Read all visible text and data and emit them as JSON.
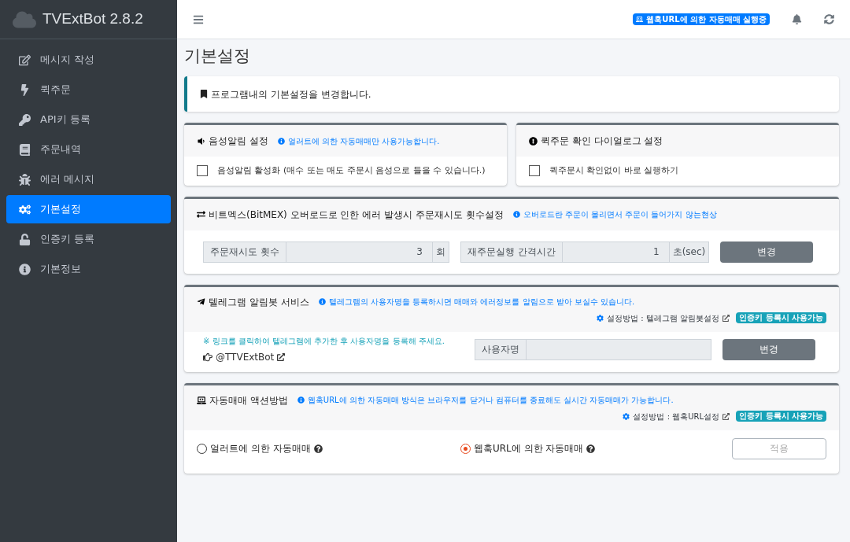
{
  "sidebar": {
    "brand": "TVExtBot 2.8.2",
    "items": [
      {
        "label": "메시지 작성",
        "selected": false
      },
      {
        "label": "퀵주문",
        "selected": false
      },
      {
        "label": "API키 등록",
        "selected": false
      },
      {
        "label": "주문내역",
        "selected": false
      },
      {
        "label": "에러 메시지",
        "selected": false
      },
      {
        "label": "기본설정",
        "selected": true
      },
      {
        "label": "인증키 등록",
        "selected": false
      },
      {
        "label": "기본정보",
        "selected": false
      }
    ]
  },
  "header": {
    "status_badge": "웹훅URL에 의한 자동매매 실행중"
  },
  "page_title": "기본설정",
  "callout": "프로그램내의 기본설정을 변경합니다.",
  "sound_card": {
    "title": "음성알림 설정",
    "note": "얼러트에 의한 자동매매만 사용가능합니다.",
    "checkbox": {
      "label": "음성알림 활성화 (매수 또는 매도 주문시 음성으로 들을 수 있습니다.)",
      "checked": false
    }
  },
  "quick_card": {
    "title": "퀵주문 확인 다이얼로그 설정",
    "checkbox": {
      "label": "퀵주문시 확인없이 바로 실행하기",
      "checked": false
    }
  },
  "retry_card": {
    "title": "비트멕스(BitMEX) 오버로드로 인한 에러 발생시 주문재시도 횟수설정",
    "note": "오버로드란 주문이 몰리면서 주문이 들어가지 않는현상",
    "fields": [
      {
        "label": "주문재시도 횟수",
        "value": "3",
        "unit": "회"
      },
      {
        "label": "재주문실행 간격시간",
        "value": "1",
        "unit": "초(sec)"
      }
    ],
    "button": "변경"
  },
  "telegram_card": {
    "title": "텔레그램 알림봇 서비스",
    "note": "텔레그램의 사용자명을 등록하시면 매매와 에러정보를 알림으로 받아 보실수 있습니다.",
    "setup_link": "설정방법 : 텔레그램 알림봇설정",
    "badge": "인증키 등록시 사용가능",
    "hint": "※ 링크를 클릭하여 텔레그램에 추가한 후 사용자명을 등록해 주세요.",
    "bot_link": "@TTVExtBot",
    "field_label": "사용자명",
    "button": "변경"
  },
  "action_card": {
    "title": "자동매매 액션방법",
    "note": "웹훅URL에 의한 자동매매 방식은 브라우저를 닫거나 컴퓨터를 종료해도 실시간 자동매매가 가능합니다.",
    "setup_link": "설정방법 : 웹훅URL설정",
    "badge": "인증키 등록시 사용가능",
    "options": [
      {
        "label": "얼러트에 의한 자동매매",
        "selected": false
      },
      {
        "label": "웹훅URL에 의한 자동매매",
        "selected": true
      }
    ],
    "button": {
      "label": "적용",
      "disabled": true
    }
  }
}
